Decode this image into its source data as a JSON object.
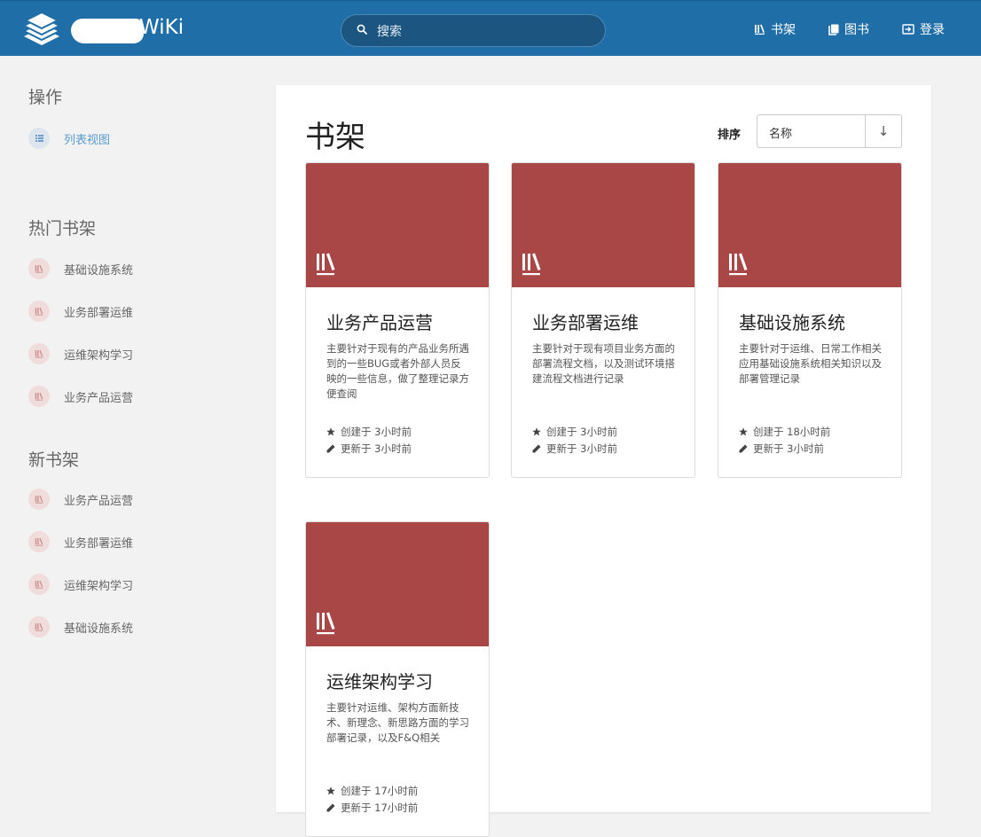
{
  "header": {
    "brand": "WiKi",
    "search_placeholder": "搜索",
    "nav": [
      {
        "label": "书架",
        "icon": "bookshelf-icon"
      },
      {
        "label": "图书",
        "icon": "book-icon"
      },
      {
        "label": "登录",
        "icon": "login-icon"
      }
    ]
  },
  "sidebar": {
    "actions_heading": "操作",
    "actions": [
      {
        "label": "列表视图",
        "icon": "list-icon"
      }
    ],
    "popular_heading": "热门书架",
    "popular": [
      {
        "label": "基础设施系统"
      },
      {
        "label": "业务部署运维"
      },
      {
        "label": "运维架构学习"
      },
      {
        "label": "业务产品运营"
      }
    ],
    "new_heading": "新书架",
    "new": [
      {
        "label": "业务产品运营"
      },
      {
        "label": "业务部署运维"
      },
      {
        "label": "运维架构学习"
      },
      {
        "label": "基础设施系统"
      }
    ]
  },
  "main": {
    "title": "书架",
    "sort_label": "排序",
    "sort_value": "名称",
    "sort_direction": "↓"
  },
  "cards": [
    {
      "title": "业务产品运营",
      "description": "主要针对于现有的产品业务所遇到的一些BUG或者外部人员反映的一些信息，做了整理记录方便查阅",
      "created": "创建于 3小时前",
      "updated": "更新于 3小时前"
    },
    {
      "title": "业务部署运维",
      "description": "主要针对于现有项目业务方面的部署流程文档，以及测试环境搭建流程文档进行记录",
      "created": "创建于 3小时前",
      "updated": "更新于 3小时前"
    },
    {
      "title": "基础设施系统",
      "description": "主要针对于运维、日常工作相关应用基础设施系统相关知识以及部署管理记录",
      "created": "创建于 18小时前",
      "updated": "更新于 3小时前"
    },
    {
      "title": "运维架构学习",
      "description": "主要针对运维、架构方面新技术、新理念、新思路方面的学习部署记录，以及F&Q相关",
      "created": "创建于 17小时前",
      "updated": "更新于 17小时前"
    }
  ],
  "colors": {
    "header": "#206ea7",
    "cover": "#a94747",
    "accent": "#5b9bd0"
  }
}
